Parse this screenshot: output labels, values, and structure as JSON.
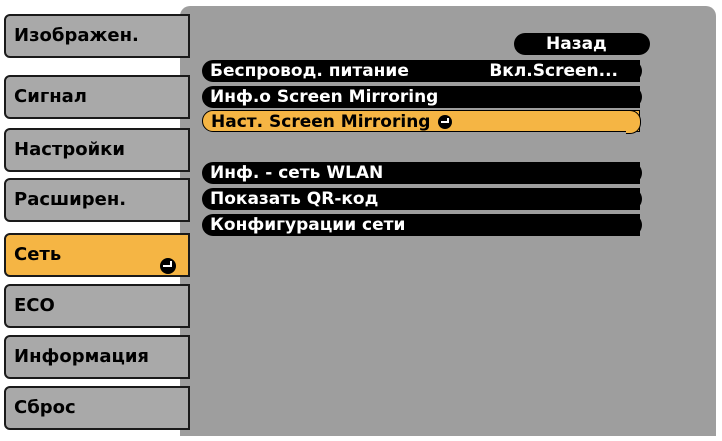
{
  "tabs": [
    {
      "label": "Изображен.",
      "active": false
    },
    {
      "label": "Сигнал",
      "active": false
    },
    {
      "label": "Настройки",
      "active": false
    },
    {
      "label": "Расширен.",
      "active": false
    },
    {
      "label": "Сеть",
      "active": true
    },
    {
      "label": "ECO",
      "active": false
    },
    {
      "label": "Информация",
      "active": false
    },
    {
      "label": "Сброс",
      "active": false
    }
  ],
  "menu": {
    "back_label": "Назад",
    "items": [
      {
        "label": "Беспровод. питание",
        "value": "Вкл.Screen..."
      },
      {
        "label": "Инф.о Screen Mirroring",
        "value": ""
      },
      {
        "label": "Наст. Screen Mirroring",
        "value": "",
        "selected": true
      },
      {
        "label": "Инф. - сеть WLAN",
        "value": ""
      },
      {
        "label": "Показать QR-код",
        "value": ""
      },
      {
        "label": "Конфигурации сети",
        "value": ""
      }
    ]
  },
  "colors": {
    "accent": "#f5b544",
    "panel": "#9e9e9e",
    "tab": "#a9a9a9"
  },
  "icons": {
    "enter": "return-icon"
  }
}
